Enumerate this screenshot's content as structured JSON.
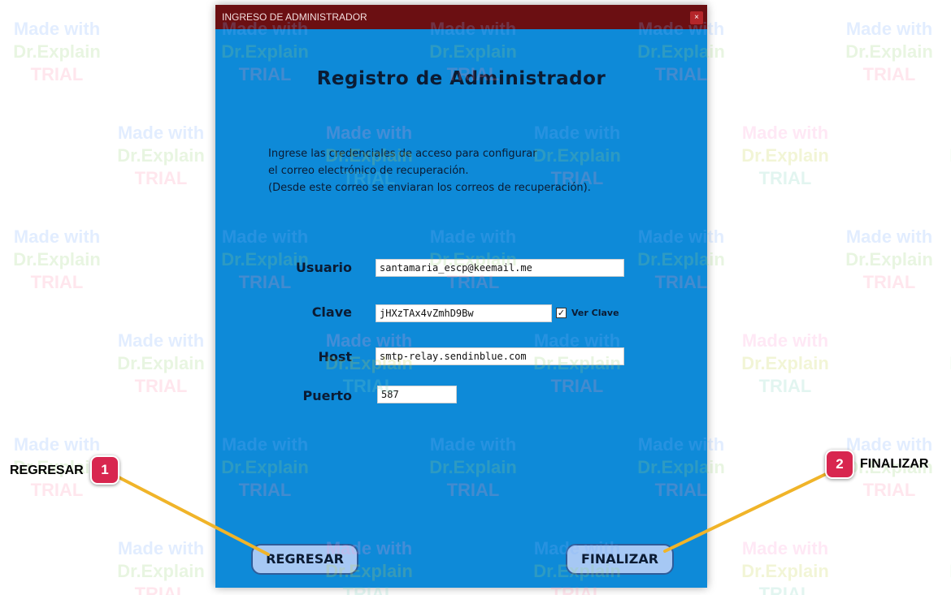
{
  "watermark": {
    "line1": "Made with",
    "line2": "Dr.Explain",
    "line3": "TRIAL"
  },
  "window": {
    "title": "INGRESO DE ADMINISTRADOR",
    "close_glyph": "×",
    "titlebar_color": "#6b0f12",
    "background_color": "#0e8ad8"
  },
  "form": {
    "heading": "Registro de Administrador",
    "instructions": [
      "Ingrese las credenciales de acceso para configurar",
      "el correo electrónico de recuperación.",
      "(Desde este correo se enviaran los correos de recuperación)."
    ],
    "fields": {
      "usuario": {
        "label": "Usuario",
        "value": "santamaria_escp@keemail.me"
      },
      "clave": {
        "label": "Clave",
        "value": "jHXzTAx4vZmhD9Bw"
      },
      "host": {
        "label": "Host",
        "value": "smtp-relay.sendinblue.com"
      },
      "puerto": {
        "label": "Puerto",
        "value": "587"
      }
    },
    "show_password": {
      "label": "Ver Clave",
      "checked": true,
      "check_glyph": "✓"
    },
    "buttons": {
      "back": "REGRESAR",
      "finish": "FINALIZAR"
    }
  },
  "callouts": [
    {
      "number": "1",
      "label": "REGRESAR"
    },
    {
      "number": "2",
      "label": "FINALIZAR"
    }
  ],
  "callout_colors": {
    "badge": "#d8264f",
    "line": "#f0b429"
  }
}
